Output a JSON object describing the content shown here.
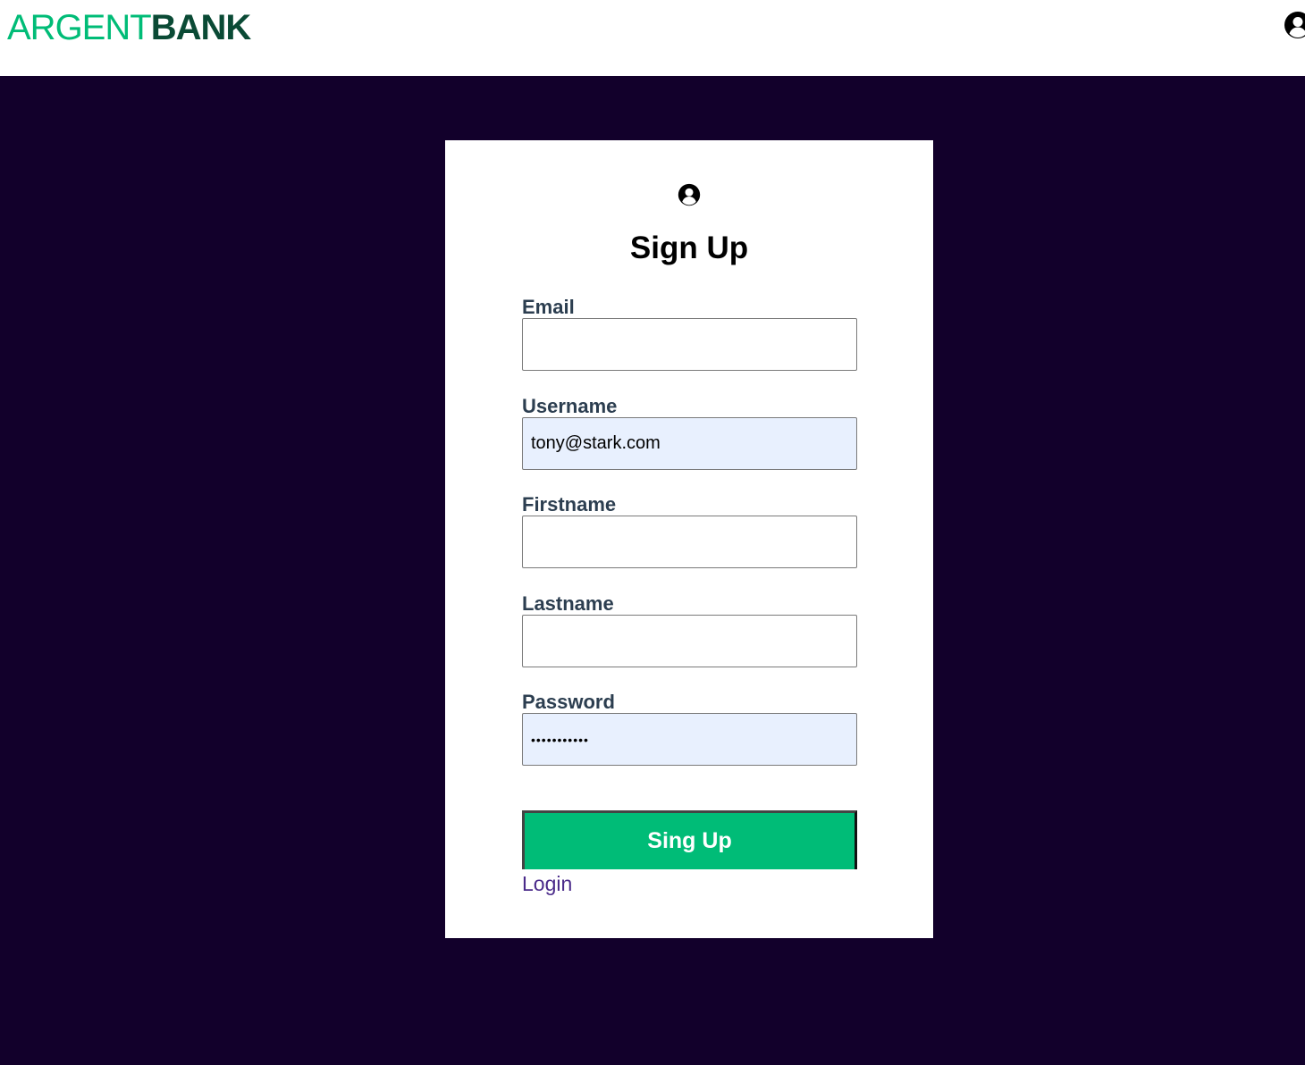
{
  "header": {
    "logo_part1": "ARGENT",
    "logo_part2": "BANK",
    "user_icon": "user-circle-icon"
  },
  "card": {
    "icon": "user-circle-icon",
    "title": "Sign Up",
    "fields": [
      {
        "label": "Email",
        "value": "",
        "type": "text"
      },
      {
        "label": "Username",
        "value": "tony@stark.com",
        "type": "text"
      },
      {
        "label": "Firstname",
        "value": "",
        "type": "text"
      },
      {
        "label": "Lastname",
        "value": "",
        "type": "text"
      },
      {
        "label": "Password",
        "value": "•••••••••••",
        "type": "password"
      }
    ],
    "submit_label": "Sing Up",
    "login_link": "Login"
  },
  "colors": {
    "brand_green": "#00bc77",
    "brand_dark_green": "#0a4a35",
    "background": "#12002b",
    "autofill": "#e8f0fe",
    "link": "#4a2a8a"
  }
}
